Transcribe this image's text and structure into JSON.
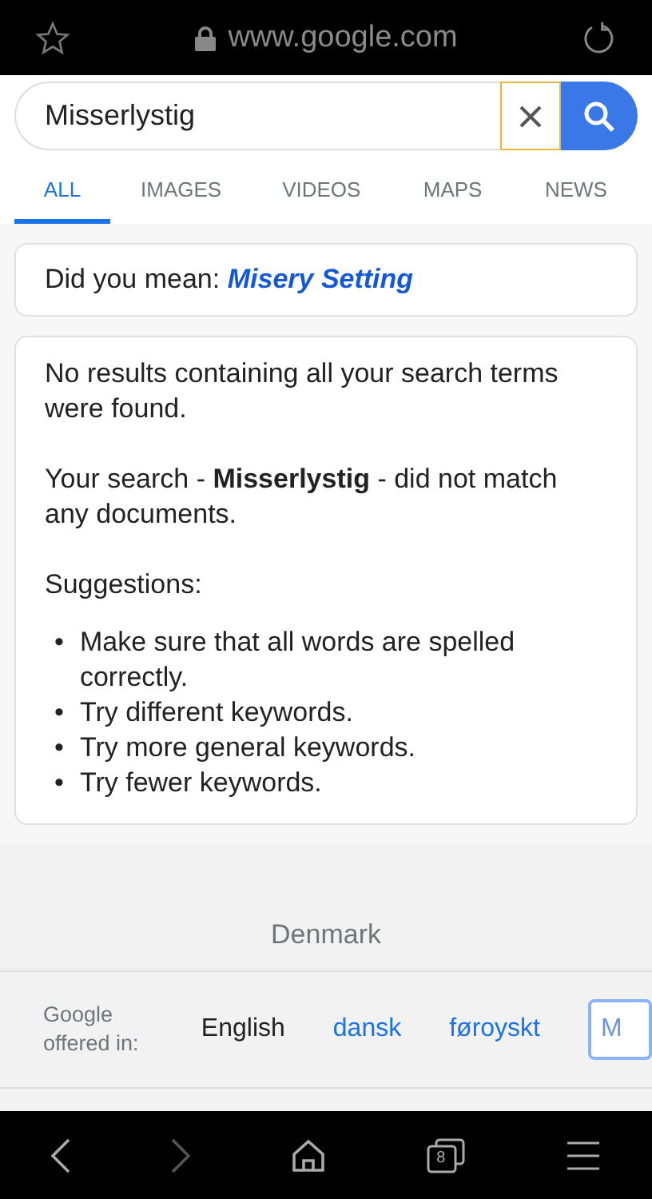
{
  "browser_bar": {
    "url": "www.google.com"
  },
  "search": {
    "value": "Misserlystig"
  },
  "tabs": [
    {
      "label": "ALL",
      "selected": true
    },
    {
      "label": "IMAGES",
      "selected": false
    },
    {
      "label": "VIDEOS",
      "selected": false
    },
    {
      "label": "MAPS",
      "selected": false
    },
    {
      "label": "NEWS",
      "selected": false
    }
  ],
  "did_you_mean": {
    "prefix": "Did you mean:",
    "suggestion": "Misery Setting"
  },
  "results": {
    "no_results": "No results containing all your search terms were found.",
    "your_search": "Your search - **Misserlystig** - did not match any documents.",
    "suggestions_title": "Suggestions:",
    "suggestions": [
      {
        "bullet": "•",
        "text": "Make sure that all words are spelled correctly."
      },
      {
        "bullet": "•",
        "text": "Try different keywords."
      },
      {
        "bullet": "•",
        "text": "Try more general keywords."
      },
      {
        "bullet": "•",
        "text": "Try fewer keywords."
      }
    ]
  },
  "footer": {
    "country": "Denmark",
    "offered_in": "Google offered in:",
    "languages": [
      {
        "label": "English",
        "selected": true
      },
      {
        "label": "dansk",
        "selected": false
      },
      {
        "label": "føroyskt",
        "selected": false
      }
    ],
    "more_button": "M"
  },
  "bottom_nav": {
    "tab_count": "8"
  }
}
